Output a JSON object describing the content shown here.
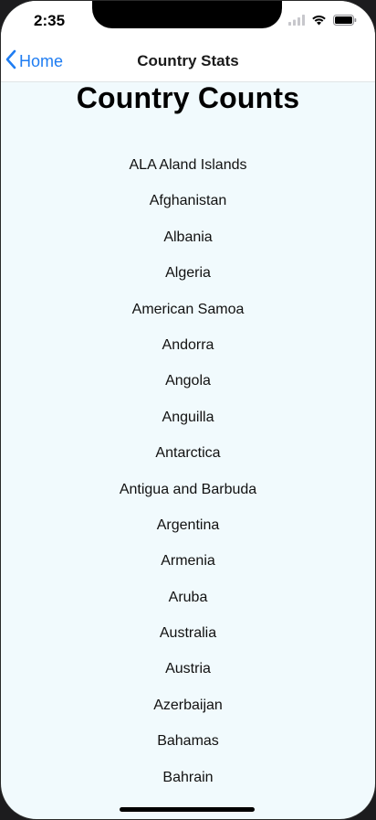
{
  "status_bar": {
    "time": "2:35",
    "icons": [
      "signal-icon",
      "wifi-icon",
      "battery-icon"
    ]
  },
  "nav": {
    "back_label": "Home",
    "title": "Country Stats",
    "accent_color": "#1f7df2"
  },
  "page": {
    "title": "Country Counts",
    "background_color": "#f1fafd"
  },
  "countries": [
    "ALA Aland Islands",
    "Afghanistan",
    "Albania",
    "Algeria",
    "American Samoa",
    "Andorra",
    "Angola",
    "Anguilla",
    "Antarctica",
    "Antigua and Barbuda",
    "Argentina",
    "Armenia",
    "Aruba",
    "Australia",
    "Austria",
    "Azerbaijan",
    "Bahamas",
    "Bahrain"
  ]
}
